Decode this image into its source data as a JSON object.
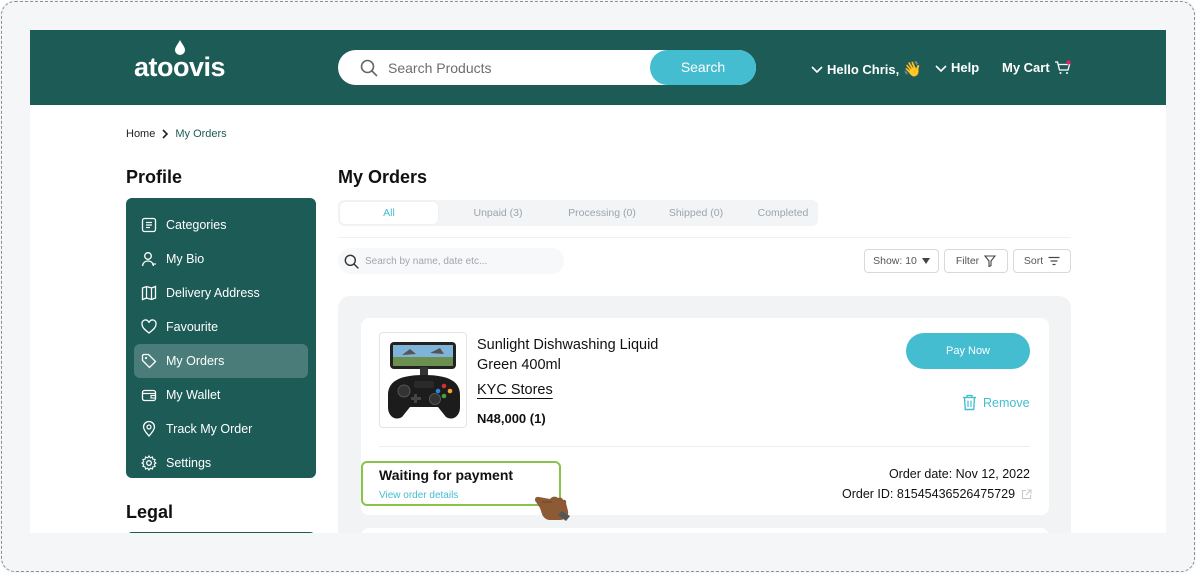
{
  "header": {
    "logo": "atoovis",
    "search_placeholder": "Search Products",
    "search_button": "Search",
    "greeting": "Hello Chris,",
    "greeting_emoji": "👋",
    "help": "Help",
    "cart": "My Cart"
  },
  "breadcrumb": {
    "home": "Home",
    "current": "My Orders"
  },
  "sidebar": {
    "title": "Profile",
    "items": [
      {
        "label": "Categories",
        "icon": "list-icon"
      },
      {
        "label": "My Bio",
        "icon": "user-icon"
      },
      {
        "label": "Delivery Address",
        "icon": "map-icon"
      },
      {
        "label": "Favourite",
        "icon": "heart-icon"
      },
      {
        "label": "My Orders",
        "icon": "tag-icon",
        "active": true
      },
      {
        "label": "My Wallet",
        "icon": "wallet-icon"
      },
      {
        "label": "Track My Order",
        "icon": "location-pin-icon"
      },
      {
        "label": "Settings",
        "icon": "gear-icon"
      }
    ],
    "legal_title": "Legal"
  },
  "main": {
    "title": "My Orders",
    "tabs": [
      {
        "label": "All",
        "active": true
      },
      {
        "label": "Unpaid (3)"
      },
      {
        "label": "Processing (0)"
      },
      {
        "label": "Shipped (0)"
      },
      {
        "label": "Completed"
      }
    ],
    "search_placeholder": "Search by name, date etc...",
    "show": "Show: 10",
    "filter": "Filter",
    "sort": "Sort"
  },
  "order": {
    "product_name": "Sunlight Dishwashing Liquid Green 400ml",
    "store": "KYC Stores",
    "price": "N48,000 (1)",
    "pay_button": "Pay Now",
    "remove": "Remove",
    "status": "Waiting for payment",
    "view_details": "View order details",
    "order_date": "Order date: Nov 12, 2022",
    "order_id": "Order ID: 81545436526475729"
  },
  "colors": {
    "brand": "#1d5b56",
    "accent": "#45bdd0",
    "highlight": "#8bc34a"
  }
}
